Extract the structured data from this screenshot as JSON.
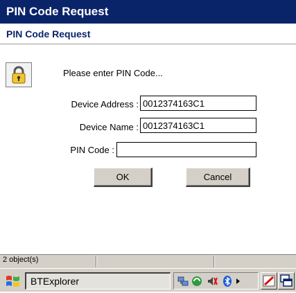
{
  "window": {
    "title": "PIN Code Request"
  },
  "dialog": {
    "header": "PIN Code Request",
    "prompt": "Please enter PIN Code...",
    "device_address_label": "Device Address :",
    "device_address_value": "0012374163C1",
    "device_name_label": "Device Name :",
    "device_name_value": "0012374163C1",
    "pin_label": "PIN Code :",
    "pin_value": "",
    "ok_label": "OK",
    "cancel_label": "Cancel"
  },
  "statusbar": {
    "text": "2 object(s)"
  },
  "taskbar": {
    "start_icon": "windows-flag-icon",
    "active_task": "BTExplorer",
    "tray_icons": [
      "network-icon",
      "sync-icon",
      "volume-icon",
      "bluetooth-icon",
      "tray-arrow-icon"
    ],
    "buttons": [
      "pen-input-icon",
      "window-switch-icon"
    ]
  },
  "colors": {
    "titlebar": "#0a246a",
    "header_text": "#0a246a",
    "chrome": "#d4d0c8"
  }
}
